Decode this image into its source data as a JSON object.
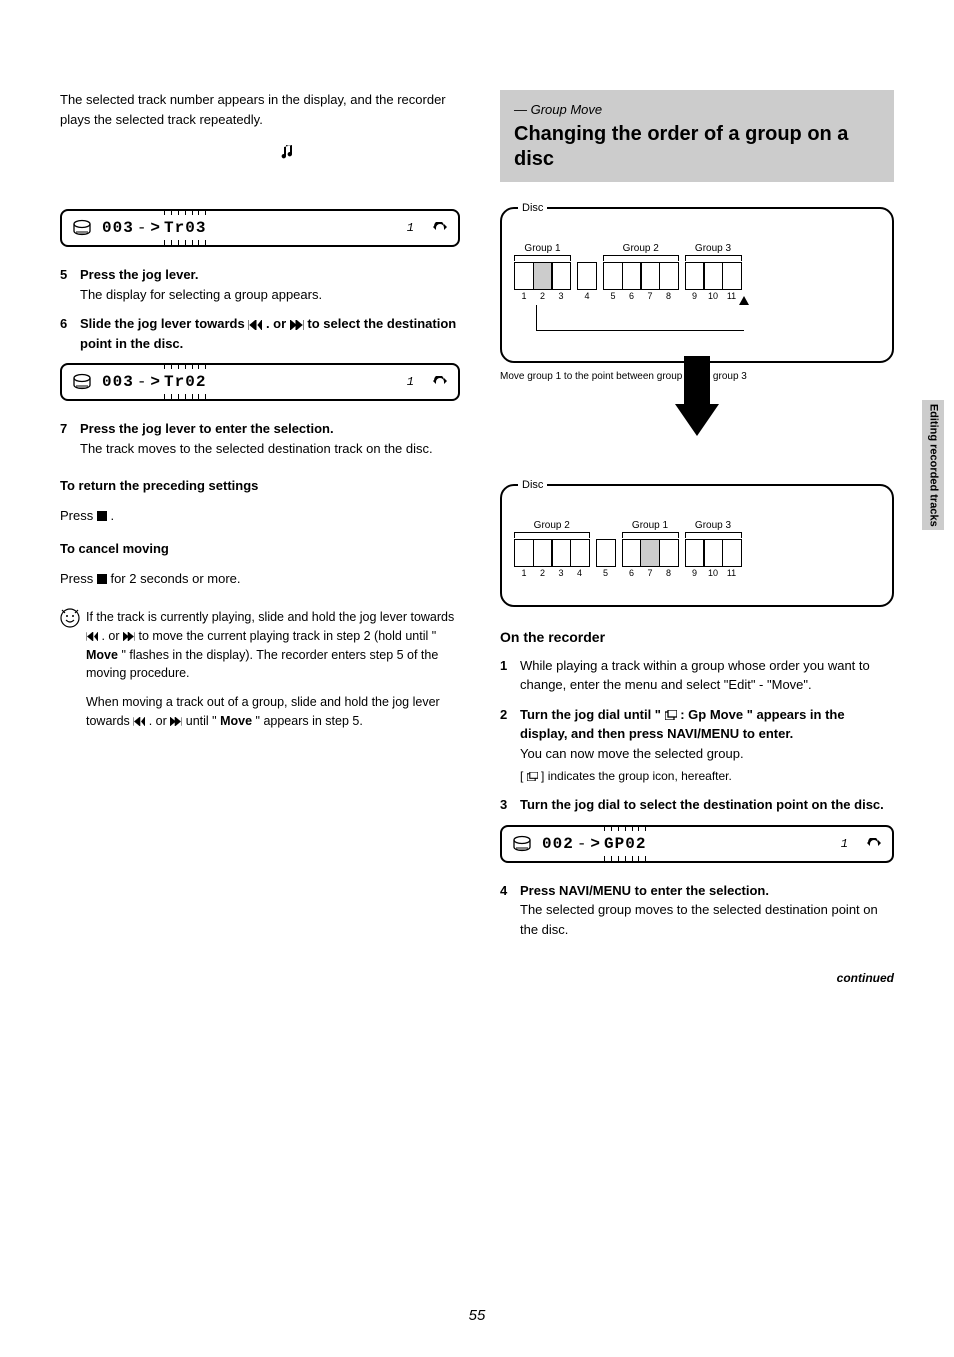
{
  "page_number": "55",
  "side_tab": "Editing recorded tracks",
  "left": {
    "intro": "The selected track number appears in the display, and the recorder plays the selected track repeatedly.",
    "lcd1": {
      "seg": "003",
      "arrow": ">",
      "blink": "Tr03",
      "one": "1"
    },
    "step5": {
      "num": "5",
      "lead": "Press the jog lever.",
      "rest": "The display for selecting a group appears."
    },
    "step6": {
      "num": "6",
      "lead": "Slide the jog lever towards ",
      "skip": ".← or →.",
      "rest": " to select the destination point in the disc."
    },
    "lcd2": {
      "seg": "003",
      "arrow": ">",
      "blink": "Tr02",
      "one": "1"
    },
    "step7": {
      "num": "7",
      "lead": "Press the jog lever to enter the selection.",
      "body": "The track moves to the selected destination track on the disc."
    },
    "cancel_title": "To return the preceding settings",
    "cancel_body_prefix": "Press ",
    "cancel_stop": "■",
    "cancel_body_suffix": ".",
    "cancel_title2": "To cancel moving",
    "cancel_body2_prefix": "Press ",
    "cancel_body2_suffix": " for 2 seconds or more.",
    "tip": {
      "lead_prefix": "If the track is currently playing, slide and hold the jog lever towards ",
      "skip2": ".← or →.",
      "lead_suffix": " to move the current playing track in step 2 (hold until \"",
      "move": "Move",
      "after_move": "\" flashes in the display). The recorder enters step 5 of the moving procedure.",
      "p2_prefix": "When moving a track out of a group, slide and hold the jog lever towards ",
      "p2_suffix": " until \"",
      "p2_suffix2": "\" appears in step 5."
    }
  },
  "right": {
    "heading_italic": "— Group Move",
    "heading_title": "Changing the order of a group on a disc",
    "diagram1": {
      "disc_label": "Disc",
      "groups": [
        {
          "label": "Group 1",
          "tracks": [
            {
              "n": "1"
            },
            {
              "n": "2",
              "hl": true
            },
            {
              "n": "3"
            }
          ]
        },
        {
          "label": "",
          "tracks": [
            {
              "n": "4"
            }
          ]
        },
        {
          "label": "Group 2",
          "tracks": [
            {
              "n": "5"
            },
            {
              "n": "6"
            },
            {
              "n": "7"
            },
            {
              "n": "8"
            }
          ]
        },
        {
          "label": "Group 3",
          "tracks": [
            {
              "n": "9"
            },
            {
              "n": "10"
            },
            {
              "n": "11"
            }
          ]
        }
      ],
      "caption": "Move group 1 to the point between group 2 and group 3"
    },
    "diagram2": {
      "disc_label": "Disc",
      "groups": [
        {
          "label": "Group 2",
          "tracks": [
            {
              "n": "1"
            },
            {
              "n": "2"
            },
            {
              "n": "3"
            },
            {
              "n": "4"
            }
          ]
        },
        {
          "label": "",
          "tracks": [
            {
              "n": "5"
            }
          ]
        },
        {
          "label": "Group 1",
          "tracks": [
            {
              "n": "6"
            },
            {
              "n": "7",
              "hl": true
            },
            {
              "n": "8"
            }
          ]
        },
        {
          "label": "Group 3",
          "tracks": [
            {
              "n": "9"
            },
            {
              "n": "10"
            },
            {
              "n": "11"
            }
          ]
        }
      ]
    },
    "subhead": "On the recorder",
    "s1": {
      "num": "1",
      "body_prefix": "While playing a track within a group whose order you want to change, enter the menu and select \"",
      "edit": "Edit",
      "mid": "\" - \"",
      "move": "Move",
      "suffix": "\"."
    },
    "s2": {
      "num": "2",
      "lead_prefix": "Turn the jog dial until \"",
      "gmove_icon": "Move",
      "gp_prefix": " : Gp Move",
      "lead_suffix": "\" appears in the display, and then press NAVI/MENU to enter.",
      "body": "You can now move the selected group.",
      "suffix_note_prefix": "[",
      "suffix_note_icon": "]",
      "suffix_note_body": " indicates the group icon, hereafter."
    },
    "s3": {
      "num": "3",
      "lead": "Turn the jog dial to select the destination point on the disc."
    },
    "lcd3": {
      "seg": "002",
      "arrow": ">",
      "blink": "GP02",
      "one": "1"
    },
    "s4": {
      "num": "4",
      "lead": "Press NAVI/MENU to enter the selection.",
      "body": "The selected group moves to the selected destination point on the disc."
    },
    "continued": "continued"
  }
}
